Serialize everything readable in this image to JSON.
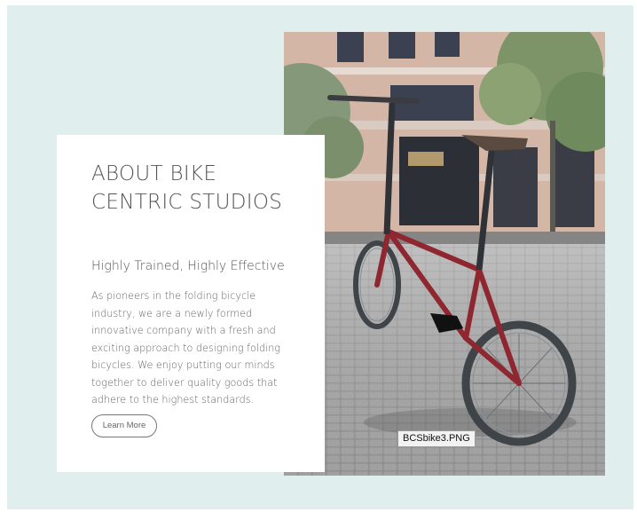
{
  "about": {
    "title": "ABOUT BIKE CENTRIC STUDIOS",
    "subtitle": "Highly Trained, Highly Effective",
    "body": "As pioneers in the folding bicycle industry, we are a newly formed innovative company with a fresh and exciting approach to designing folding bicycles. We enjoy putting our minds together to deliver quality goods that adhere to the highest standards.",
    "button_label": "Learn More"
  },
  "image": {
    "filename": "BCSbike3.PNG"
  },
  "colors": {
    "page_background": "#e1eeee",
    "card_background": "#ffffff",
    "bike_frame": "#8e2730"
  }
}
